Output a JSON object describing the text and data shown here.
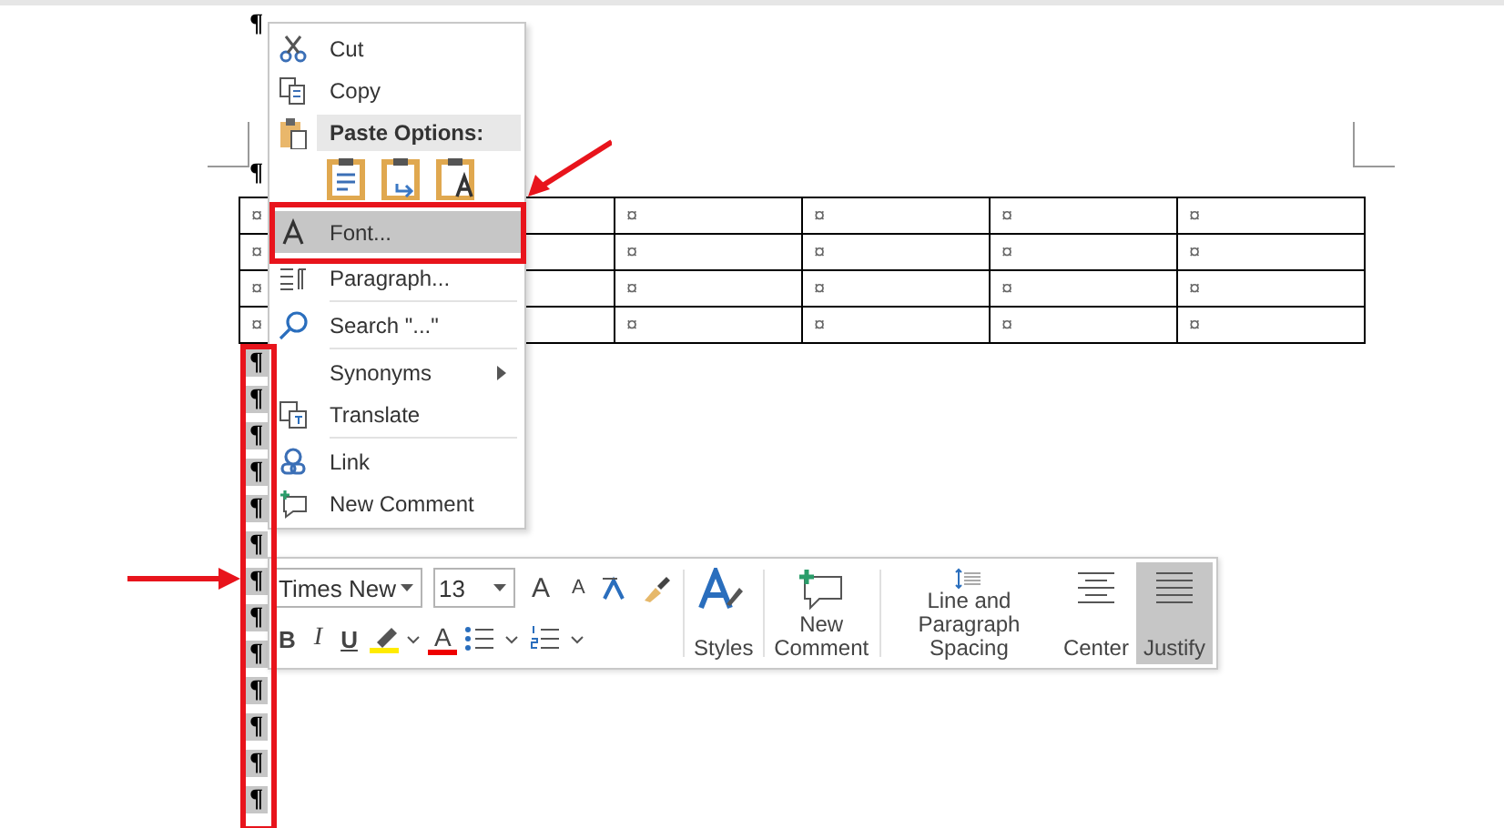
{
  "document": {
    "top_mark": "¶",
    "mark_before_table": "¶",
    "table": {
      "rows": [
        {
          "cells": [
            "¤",
            "¤",
            "¤",
            "¤",
            "¤"
          ]
        },
        {
          "cells": [
            "¤",
            "¤",
            "¤",
            "¤",
            "¤"
          ]
        },
        {
          "cells": [
            "¤",
            "¤",
            "¤",
            "¤",
            "¤"
          ]
        },
        {
          "cells": [
            "¤",
            "¤",
            "¤",
            "¤",
            "¤"
          ]
        }
      ]
    },
    "marks": [
      {
        "text": "¶",
        "selected": true
      },
      {
        "text": "¶",
        "selected": true
      },
      {
        "text": "¶",
        "selected": true
      },
      {
        "text": "¶",
        "selected": true
      },
      {
        "text": "¶",
        "selected": true
      },
      {
        "text": "¶",
        "selected": true
      },
      {
        "text": "¶",
        "selected": true
      },
      {
        "text": "¶",
        "selected": true
      },
      {
        "text": "¶",
        "selected": true
      },
      {
        "text": "¶",
        "selected": true
      },
      {
        "text": "¶",
        "selected": true
      },
      {
        "text": "¶",
        "selected": true
      },
      {
        "text": "¶",
        "selected": true
      }
    ]
  },
  "context_menu": {
    "items": [
      {
        "kind": "item",
        "label": "Cut",
        "selected": false
      },
      {
        "kind": "item",
        "label": "Copy",
        "selected": false
      },
      {
        "kind": "header",
        "label": "Paste Options:"
      },
      {
        "kind": "paste"
      },
      {
        "kind": "item",
        "label": "Font...",
        "selected": true
      },
      {
        "kind": "item",
        "label": "Paragraph...",
        "selected": false
      },
      {
        "kind": "separator"
      },
      {
        "kind": "item",
        "label": "Search \"...\"",
        "selected": false
      },
      {
        "kind": "separator"
      },
      {
        "kind": "submenu",
        "label": "Synonyms",
        "selected": false
      },
      {
        "kind": "item",
        "label": "Translate",
        "selected": false
      },
      {
        "kind": "separator"
      },
      {
        "kind": "item",
        "label": "Link",
        "selected": false
      },
      {
        "kind": "item",
        "label": "New Comment",
        "selected": false
      }
    ]
  },
  "mini_toolbar": {
    "font_name": "Times New",
    "font_size": "13",
    "grow_font": "A",
    "shrink_font": "A",
    "bold": "B",
    "italic": "I",
    "underline": "U",
    "font_color": "A",
    "buttons": [
      {
        "label": "Styles",
        "selected": false
      },
      {
        "label": "New Comment",
        "selected": false
      },
      {
        "label": "Line and Paragraph Spacing",
        "selected": false
      },
      {
        "label": "Center",
        "selected": false
      },
      {
        "label": "Justify",
        "selected": true
      }
    ]
  }
}
